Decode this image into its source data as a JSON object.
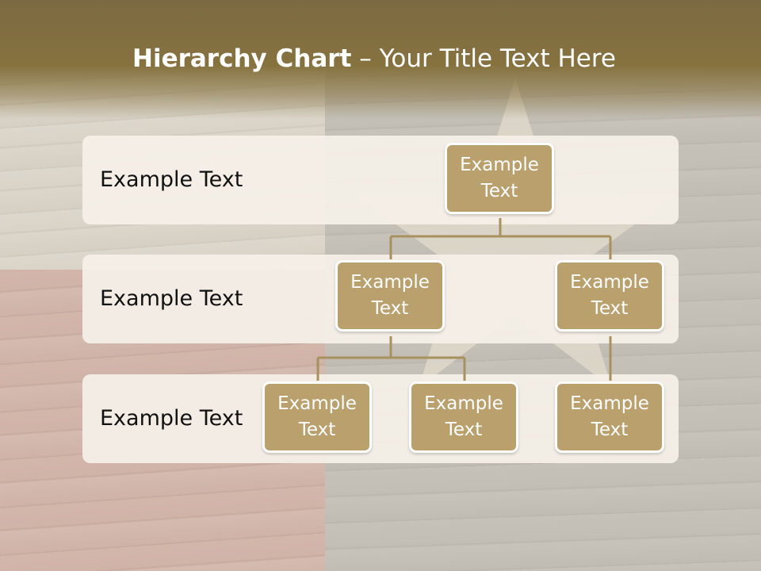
{
  "title": {
    "bold": "Hierarchy Chart",
    "rest": " – Your Title Text Here"
  },
  "levels": [
    {
      "label": "Example Text"
    },
    {
      "label": "Example Text"
    },
    {
      "label": "Example Text"
    }
  ],
  "nodes": {
    "root": "Example Text",
    "l2_left": "Example Text",
    "l2_right": "Example Text",
    "l3_a": "Example Text",
    "l3_b": "Example Text",
    "l3_c": "Example Text"
  },
  "colors": {
    "title_band": "#86723f",
    "node_fill": "#b9a06d",
    "node_border": "#ffffff",
    "band_fill": "#f5f0e8",
    "connector": "#a8915f"
  }
}
